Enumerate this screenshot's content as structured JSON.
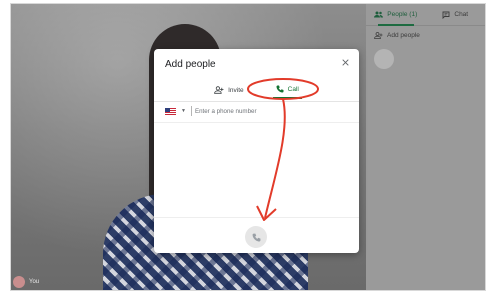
{
  "self_name": "You",
  "side_panel": {
    "tabs": [
      {
        "label": "People (1)",
        "icon": "people-icon"
      },
      {
        "label": "Chat",
        "icon": "chat-icon"
      }
    ],
    "add_people_label": "Add people"
  },
  "dialog": {
    "title": "Add people",
    "close_icon": "close-icon",
    "tabs": [
      {
        "label": "Invite",
        "icon": "person-add-icon"
      },
      {
        "label": "Call",
        "icon": "phone-icon"
      }
    ],
    "active_tab": "Call",
    "phone": {
      "country": "United States",
      "placeholder": "Enter a phone number",
      "value": ""
    },
    "call_button_icon": "phone-icon"
  },
  "colors": {
    "accent": "#137333",
    "annotation": "#e23b2a"
  }
}
